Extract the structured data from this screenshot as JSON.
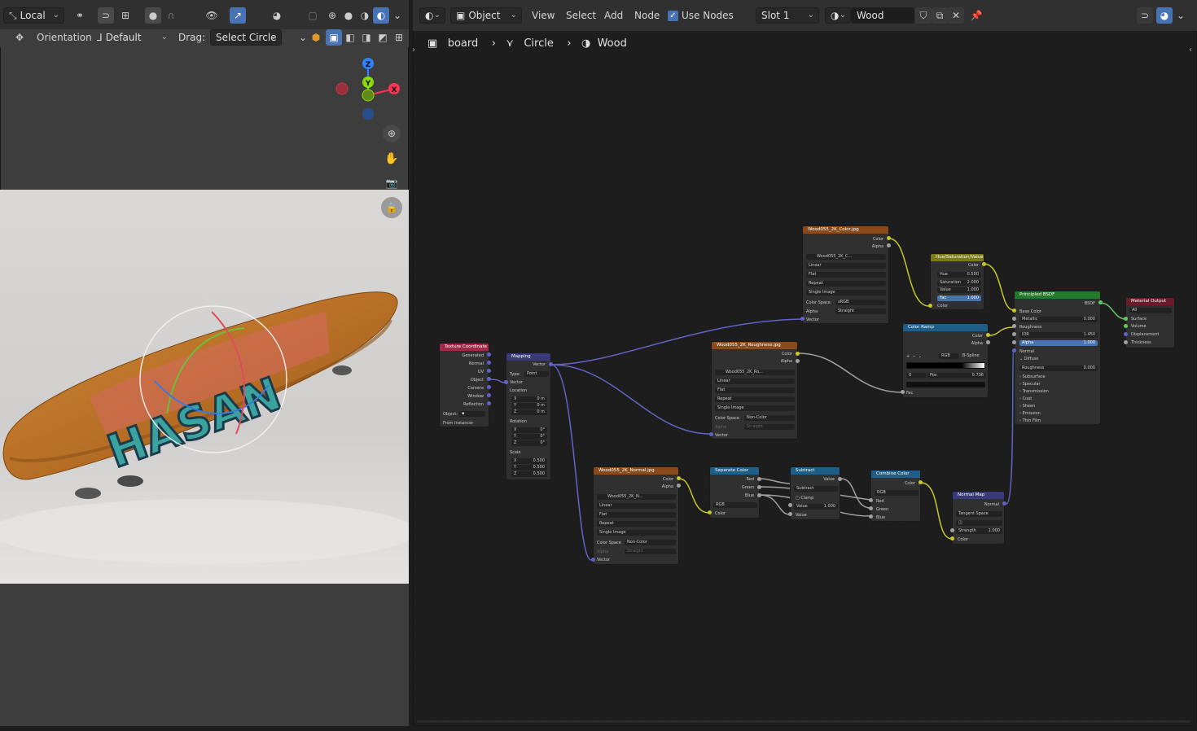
{
  "viewport": {
    "transform_space": "Local",
    "orientation_label": "Orientation:",
    "orientation_value": "Default",
    "drag_label": "Drag:",
    "drag_value": "Select Circle",
    "gizmo": {
      "z": "Z",
      "y": "Y",
      "x": "X"
    },
    "photo_text": "HASAN"
  },
  "node_editor": {
    "editor_type": "Object",
    "menu": [
      "View",
      "Select",
      "Add",
      "Node"
    ],
    "use_nodes_label": "Use Nodes",
    "use_nodes_checked": true,
    "slot": "Slot 1",
    "material": "Wood",
    "breadcrumb": [
      "board",
      "Circle",
      "Wood"
    ]
  },
  "nodes": {
    "tex_coord": {
      "title": "Texture Coordinate",
      "outputs": [
        "Generated",
        "Normal",
        "UV",
        "Object",
        "Camera",
        "Window",
        "Reflection"
      ],
      "object_label": "Object:",
      "from_instancer": "From Instancer"
    },
    "mapping": {
      "title": "Mapping",
      "output": "Vector",
      "type_label": "Type:",
      "type_value": "Point",
      "vector": "Vector",
      "location": "Location",
      "loc": [
        "X",
        "0 m",
        "Y",
        "0 m",
        "Z",
        "0 m"
      ],
      "rotation": "Rotation",
      "rot": [
        "X",
        "0°",
        "Y",
        "0°",
        "Z",
        "0°"
      ],
      "scale": "Scale",
      "scl": [
        "X",
        "0.500",
        "Y",
        "0.500",
        "Z",
        "0.500"
      ]
    },
    "color_tex": {
      "title": "Wood055_2K_Color.jpg",
      "outputs": [
        "Color",
        "Alpha"
      ],
      "image": "Wood055_2K_C...",
      "interp": "Linear",
      "proj": "Flat",
      "ext": "Repeat",
      "source": "Single Image",
      "cs_label": "Color Space",
      "cs_value": "sRGB",
      "alpha_label": "Alpha",
      "alpha_value": "Straight",
      "input": "Vector"
    },
    "rough_tex": {
      "title": "Wood055_2K_Roughness.jpg",
      "outputs": [
        "Color",
        "Alpha"
      ],
      "image": "Wood055_2K_Ro...",
      "interp": "Linear",
      "proj": "Flat",
      "ext": "Repeat",
      "source": "Single Image",
      "cs_label": "Color Space",
      "cs_value": "Non-Color",
      "alpha_label": "Alpha",
      "alpha_value": "Straight",
      "input": "Vector"
    },
    "normal_tex": {
      "title": "Wood055_2K_Normal.jpg",
      "outputs": [
        "Color",
        "Alpha"
      ],
      "image": "Wood055_2K_N...",
      "interp": "Linear",
      "proj": "Flat",
      "ext": "Repeat",
      "source": "Single Image",
      "cs_label": "Color Space",
      "cs_value": "Non-Color",
      "alpha_label": "Alpha",
      "alpha_value": "Straight",
      "input": "Vector"
    },
    "hsv": {
      "title": "Hue/Saturation/Value",
      "output": "Color",
      "fields": [
        [
          "Hue",
          "0.500"
        ],
        [
          "Saturation",
          "2.000"
        ],
        [
          "Value",
          "1.000"
        ],
        [
          "Fac",
          "1.000"
        ]
      ],
      "input": "Color"
    },
    "ramp": {
      "title": "Color Ramp",
      "outputs": [
        "Color",
        "Alpha"
      ],
      "mode": "RGB",
      "interp": "B-Spline",
      "index": "0",
      "pos_label": "Pos",
      "pos_value": "0.736",
      "input": "Fac"
    },
    "bsdf": {
      "title": "Principled BSDF",
      "output": "BSDF",
      "rows": [
        "Base Color",
        "Metallic",
        "Roughness",
        "IOR",
        "Alpha",
        "Normal",
        "Diffuse",
        "Roughness",
        "Subsurface",
        "Specular",
        "Transmission",
        "Coat",
        "Sheen",
        "Emission",
        "Thin Film"
      ],
      "metallic": "0.000",
      "ior": "1.450",
      "alpha": "1.000",
      "roughness": "0.000"
    },
    "output": {
      "title": "Material Output",
      "target": "All",
      "inputs": [
        "Surface",
        "Volume",
        "Displacement",
        "Thickness"
      ]
    },
    "separate": {
      "title": "Separate Color",
      "outputs": [
        "Red",
        "Green",
        "Blue"
      ],
      "mode": "RGB",
      "input": "Color"
    },
    "subtract": {
      "title": "Subtract",
      "output": "Value",
      "op": "Subtract",
      "clamp": "Clamp",
      "value_label": "Value",
      "value": "1.000",
      "input": "Value"
    },
    "combine": {
      "title": "Combine Color",
      "output": "Color",
      "mode": "RGB",
      "inputs": [
        "Red",
        "Green",
        "Blue"
      ]
    },
    "normal_map": {
      "title": "Normal Map",
      "output": "Normal",
      "space": "Tangent Space",
      "strength_label": "Strength",
      "strength": "1.000",
      "input": "Color"
    }
  },
  "colors": {
    "texture_header": "#8a4a1a",
    "input_header": "#a32a47",
    "vector_header": "#3a3a7a",
    "color_header": "#7a7a18",
    "converter_header": "#1d5f8a",
    "shader_header": "#237a2b",
    "output_header": "#6a1a28",
    "wire_vector": "#6363c7",
    "wire_color": "#c7c729",
    "wire_gray": "#a1a1a1",
    "wire_shader": "#63c763"
  }
}
